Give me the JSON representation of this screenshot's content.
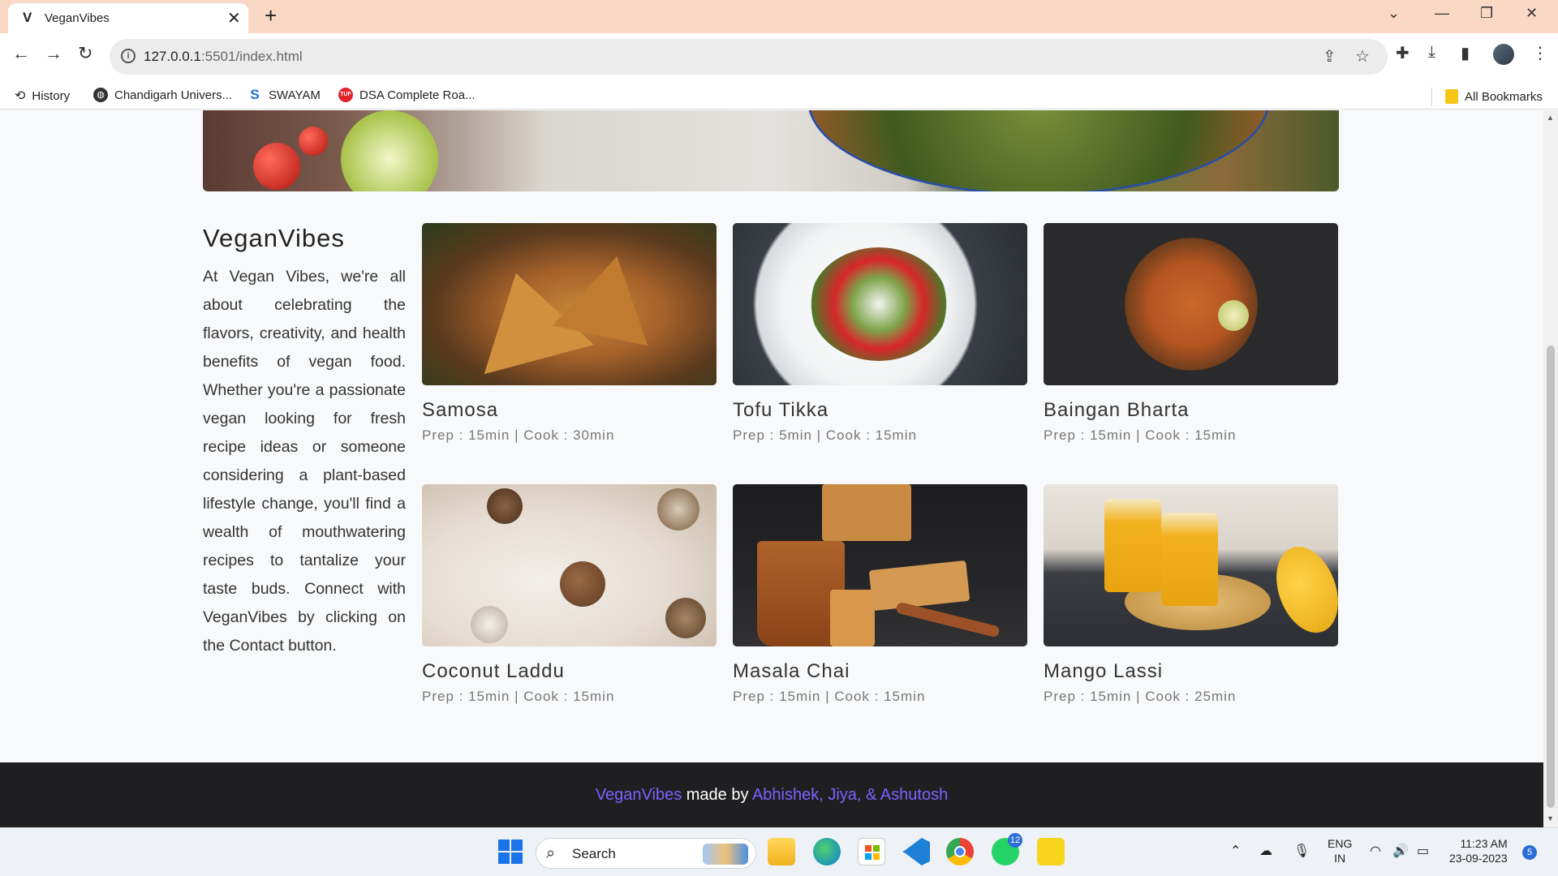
{
  "browser": {
    "tab_title": "VeganVibes",
    "tab_favicon": "V",
    "url_host": "127.0.0.1",
    "url_rest": ":5501/index.html",
    "bookmarks": [
      {
        "label": "History",
        "icon": "history-icon"
      },
      {
        "label": "Chandigarh Univers...",
        "icon": "globe-icon"
      },
      {
        "label": "SWAYAM",
        "icon": "swayam-icon"
      },
      {
        "label": "DSA Complete Roa...",
        "icon": "tuf-icon"
      }
    ],
    "all_bookmarks": "All Bookmarks"
  },
  "about": {
    "title": "VeganVibes",
    "text": "At Vegan Vibes, we're all about celebrating the flavors, creativity, and health benefits of vegan food. Whether you're a passionate vegan looking for fresh recipe ideas or someone considering a plant-based lifestyle change, you'll find a wealth of mouthwatering recipes to tantalize your taste buds. Connect with VeganVibes by clicking on the Contact button."
  },
  "recipes": [
    {
      "title": "Samosa",
      "meta": "Prep : 15min | Cook : 30min"
    },
    {
      "title": "Tofu Tikka",
      "meta": "Prep : 5min | Cook : 15min"
    },
    {
      "title": "Baingan Bharta",
      "meta": "Prep : 15min | Cook : 15min"
    },
    {
      "title": "Coconut Laddu",
      "meta": "Prep : 15min | Cook : 15min"
    },
    {
      "title": "Masala Chai",
      "meta": "Prep : 15min | Cook : 15min"
    },
    {
      "title": "Mango Lassi",
      "meta": "Prep : 15min | Cook : 25min"
    }
  ],
  "footer": {
    "brand": "VeganVibes",
    "made_by": " made by ",
    "authors": "Abhishek, Jiya, & Ashutosh"
  },
  "taskbar": {
    "search_label": "Search",
    "whatsapp_badge": "12",
    "lang_top": "ENG",
    "lang_bottom": "IN",
    "time": "11:23 AM",
    "date": "23-09-2023",
    "notification_count": "5"
  },
  "colors": {
    "accent": "#7a63ff",
    "footer_bg": "#1f1f21",
    "tabbar_bg": "#f9d9c6"
  }
}
